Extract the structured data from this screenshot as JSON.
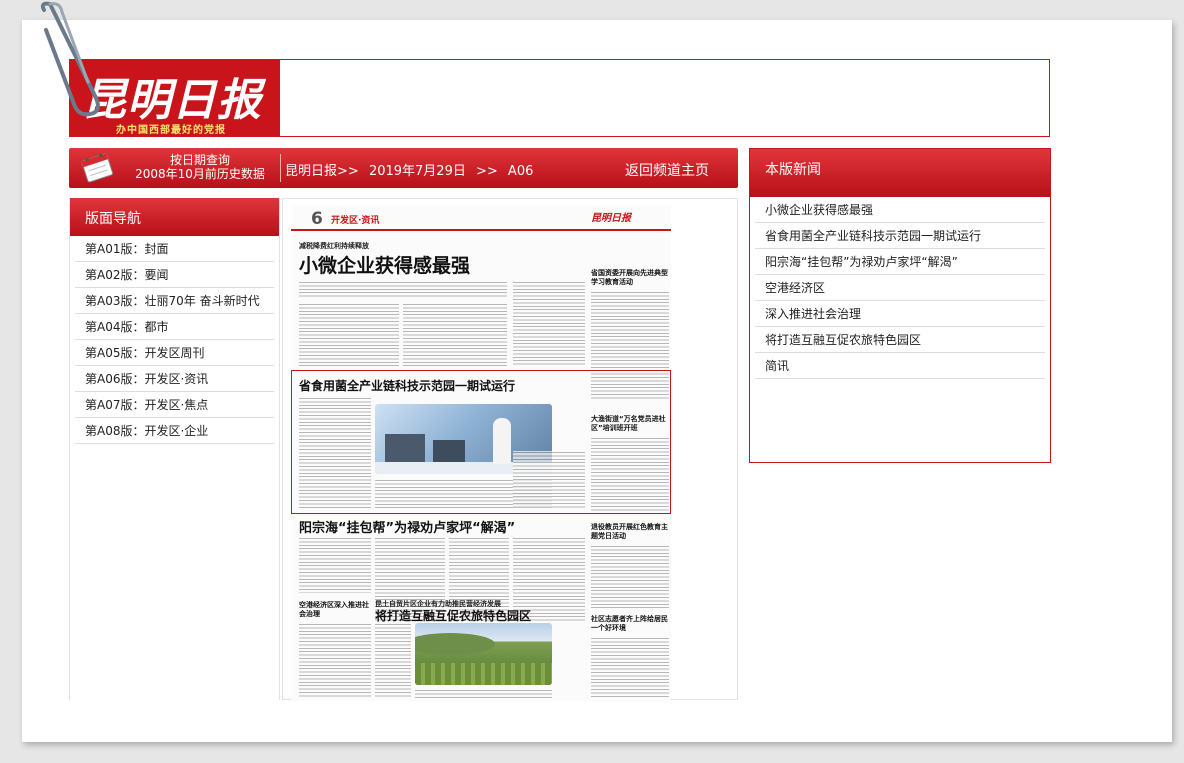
{
  "masthead": {
    "logo_text": "昆明日报",
    "slogan": "办中国西部最好的党报"
  },
  "navbar": {
    "date_query_line1": "按日期查询",
    "date_query_line2": "2008年10月前历史数据",
    "breadcrumb_paper": "昆明日报>>",
    "breadcrumb_date": "2019年7月29日",
    "breadcrumb_sep": ">>",
    "breadcrumb_page": "A06",
    "home_link": "返回频道主页",
    "icon": "calendar-icon"
  },
  "left_nav": {
    "title": "版面导航",
    "editions": [
      "第A01版：封面",
      "第A02版：要闻",
      "第A03版：壮丽70年 奋斗新时代",
      "第A04版：都市",
      "第A05版：开发区周刊",
      "第A06版：开发区·资讯",
      "第A07版：开发区·焦点",
      "第A08版：开发区·企业"
    ]
  },
  "page_image": {
    "page_number": "6",
    "section": "开发区·资讯",
    "logo": "昆明日报",
    "kicker1": "减税降费红利持续释放",
    "headline1": "小微企业获得感最强",
    "headline2": "省食用菌全产业链科技示范园一期试运行",
    "headline3": "阳宗海“挂包帮”为禄劝卢家坪“解渴”",
    "kicker4": "昆土自贸片区企业有力助推民营经济发展",
    "headline4": "将打造互融互促农旅特色园区",
    "side1": "省国资委开展向先进典型学习教育活动",
    "side2": "大渔街道“万名党员进社区”培训班开班",
    "side3": "空港经济区深入推进社会治理",
    "side4": "退役教员开展红色教育主题党日活动",
    "side5": "社区志愿者齐上阵给居民一个好环境"
  },
  "right_panel": {
    "title": "本版新闻",
    "items": [
      "小微企业获得感最强",
      "省食用菌全产业链科技示范园一期试运行",
      "阳宗海“挂包帮”为禄劝卢家坪“解渴”",
      "空港经济区",
      "深入推进社会治理",
      "将打造互融互促农旅特色园区",
      "简讯"
    ]
  },
  "colors": {
    "brand_red": "#c8141a",
    "bar_gradient_top": "#e0353a",
    "bar_gradient_bottom": "#b8101a"
  }
}
